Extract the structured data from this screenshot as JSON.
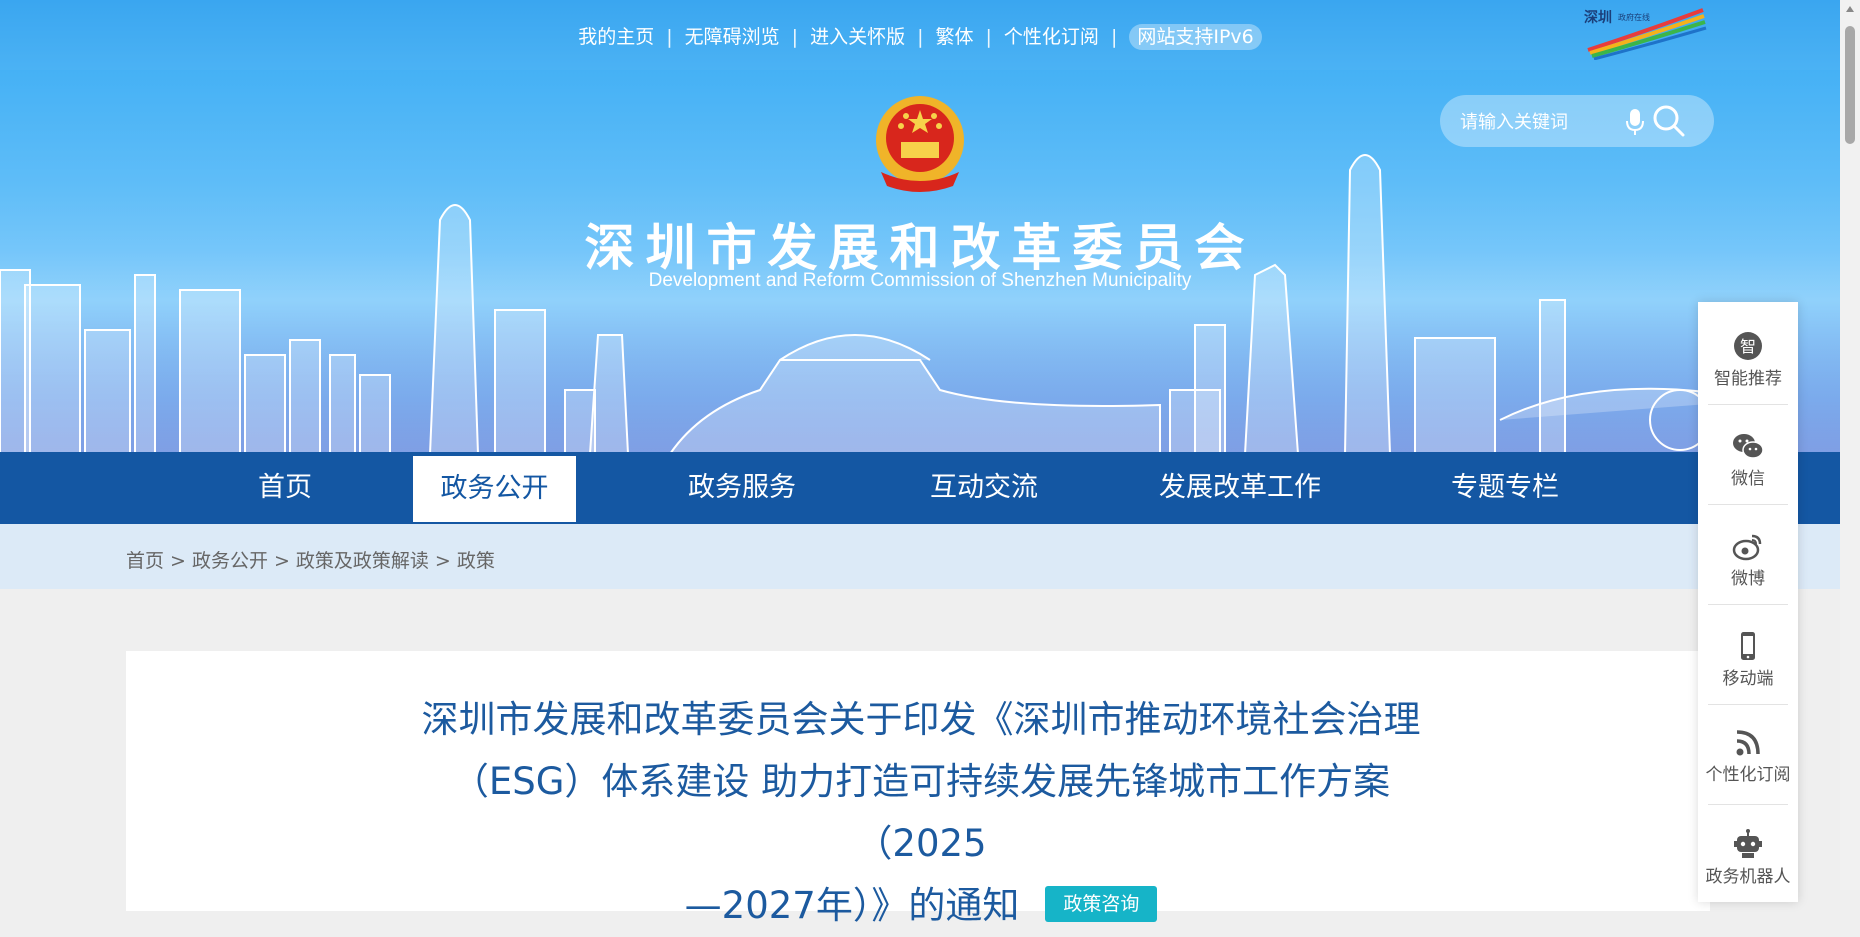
{
  "top_links": {
    "home": "我的主页",
    "accessible": "无障碍浏览",
    "care": "进入关怀版",
    "traditional": "繁体",
    "subscribe": "个性化订阅",
    "ipv6": "网站支持IPv6"
  },
  "header": {
    "title": "深圳市发展和改革委员会",
    "subtitle": "Development and Reform Commission of Shenzhen Municipality"
  },
  "search": {
    "placeholder": "请输入关键词"
  },
  "nav": [
    {
      "label": "首页"
    },
    {
      "label": "政务公开",
      "active": true
    },
    {
      "label": "政务服务"
    },
    {
      "label": "互动交流"
    },
    {
      "label": "发展改革工作"
    },
    {
      "label": "专题专栏"
    }
  ],
  "breadcrumb": [
    "首页",
    "政务公开",
    "政策及政策解读",
    "政策"
  ],
  "article": {
    "title_line1": "深圳市发展和改革委员会关于印发《深圳市推动环境社会治理",
    "title_line2": "（ESG）体系建设 助力打造可持续发展先锋城市工作方案（2025",
    "title_line3": "—2027年）》的通知",
    "tag": "政策咨询"
  },
  "side_panel": [
    {
      "label": "智能推荐",
      "icon": "smart-recommend-icon"
    },
    {
      "label": "微信",
      "icon": "wechat-icon"
    },
    {
      "label": "微博",
      "icon": "weibo-icon"
    },
    {
      "label": "移动端",
      "icon": "mobile-icon"
    },
    {
      "label": "个性化订阅",
      "icon": "rss-icon"
    },
    {
      "label": "政务机器人",
      "icon": "robot-icon"
    }
  ],
  "colors": {
    "nav_bg": "#1457a3",
    "title_blue": "#1c5a9f",
    "tag_teal": "#16b4c8",
    "breadcrumb_bg": "#dceaf7"
  }
}
